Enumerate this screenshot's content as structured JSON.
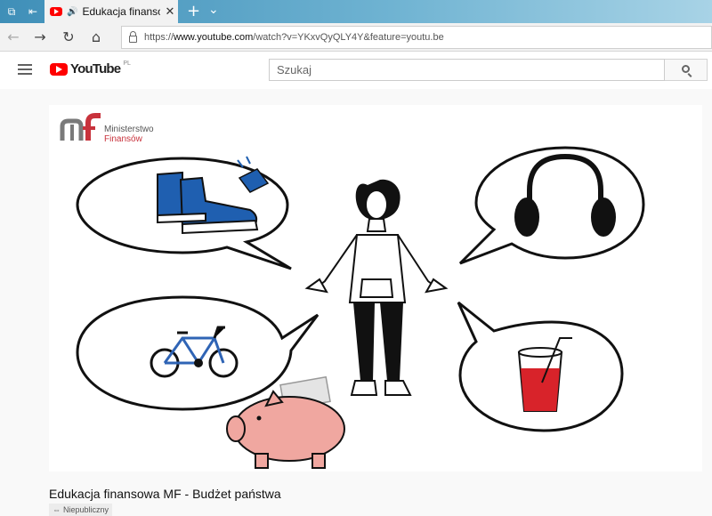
{
  "browser": {
    "tab_title": "Edukacja finansowa",
    "url_prefix": "https://",
    "url_host": "www.youtube.com",
    "url_path": "/watch?v=YKxvQyQLY4Y&feature=youtu.be"
  },
  "youtube": {
    "logo_text": "YouTube",
    "region": "PL",
    "search_placeholder": "Szukaj"
  },
  "video": {
    "logo_line1": "Ministerstwo",
    "logo_line2": "Finansów",
    "title": "Edukacja finansowa MF - Budżet państwa",
    "visibility": "Niepubliczny"
  },
  "colors": {
    "youtube_red": "#ff0000",
    "mf_gray": "#7a7a7a",
    "mf_red": "#c8323c",
    "shoe_blue": "#1f5fb0",
    "bike_blue": "#2f64b5",
    "juice_red": "#d8232a",
    "piggy_pink": "#f0a7a0"
  }
}
